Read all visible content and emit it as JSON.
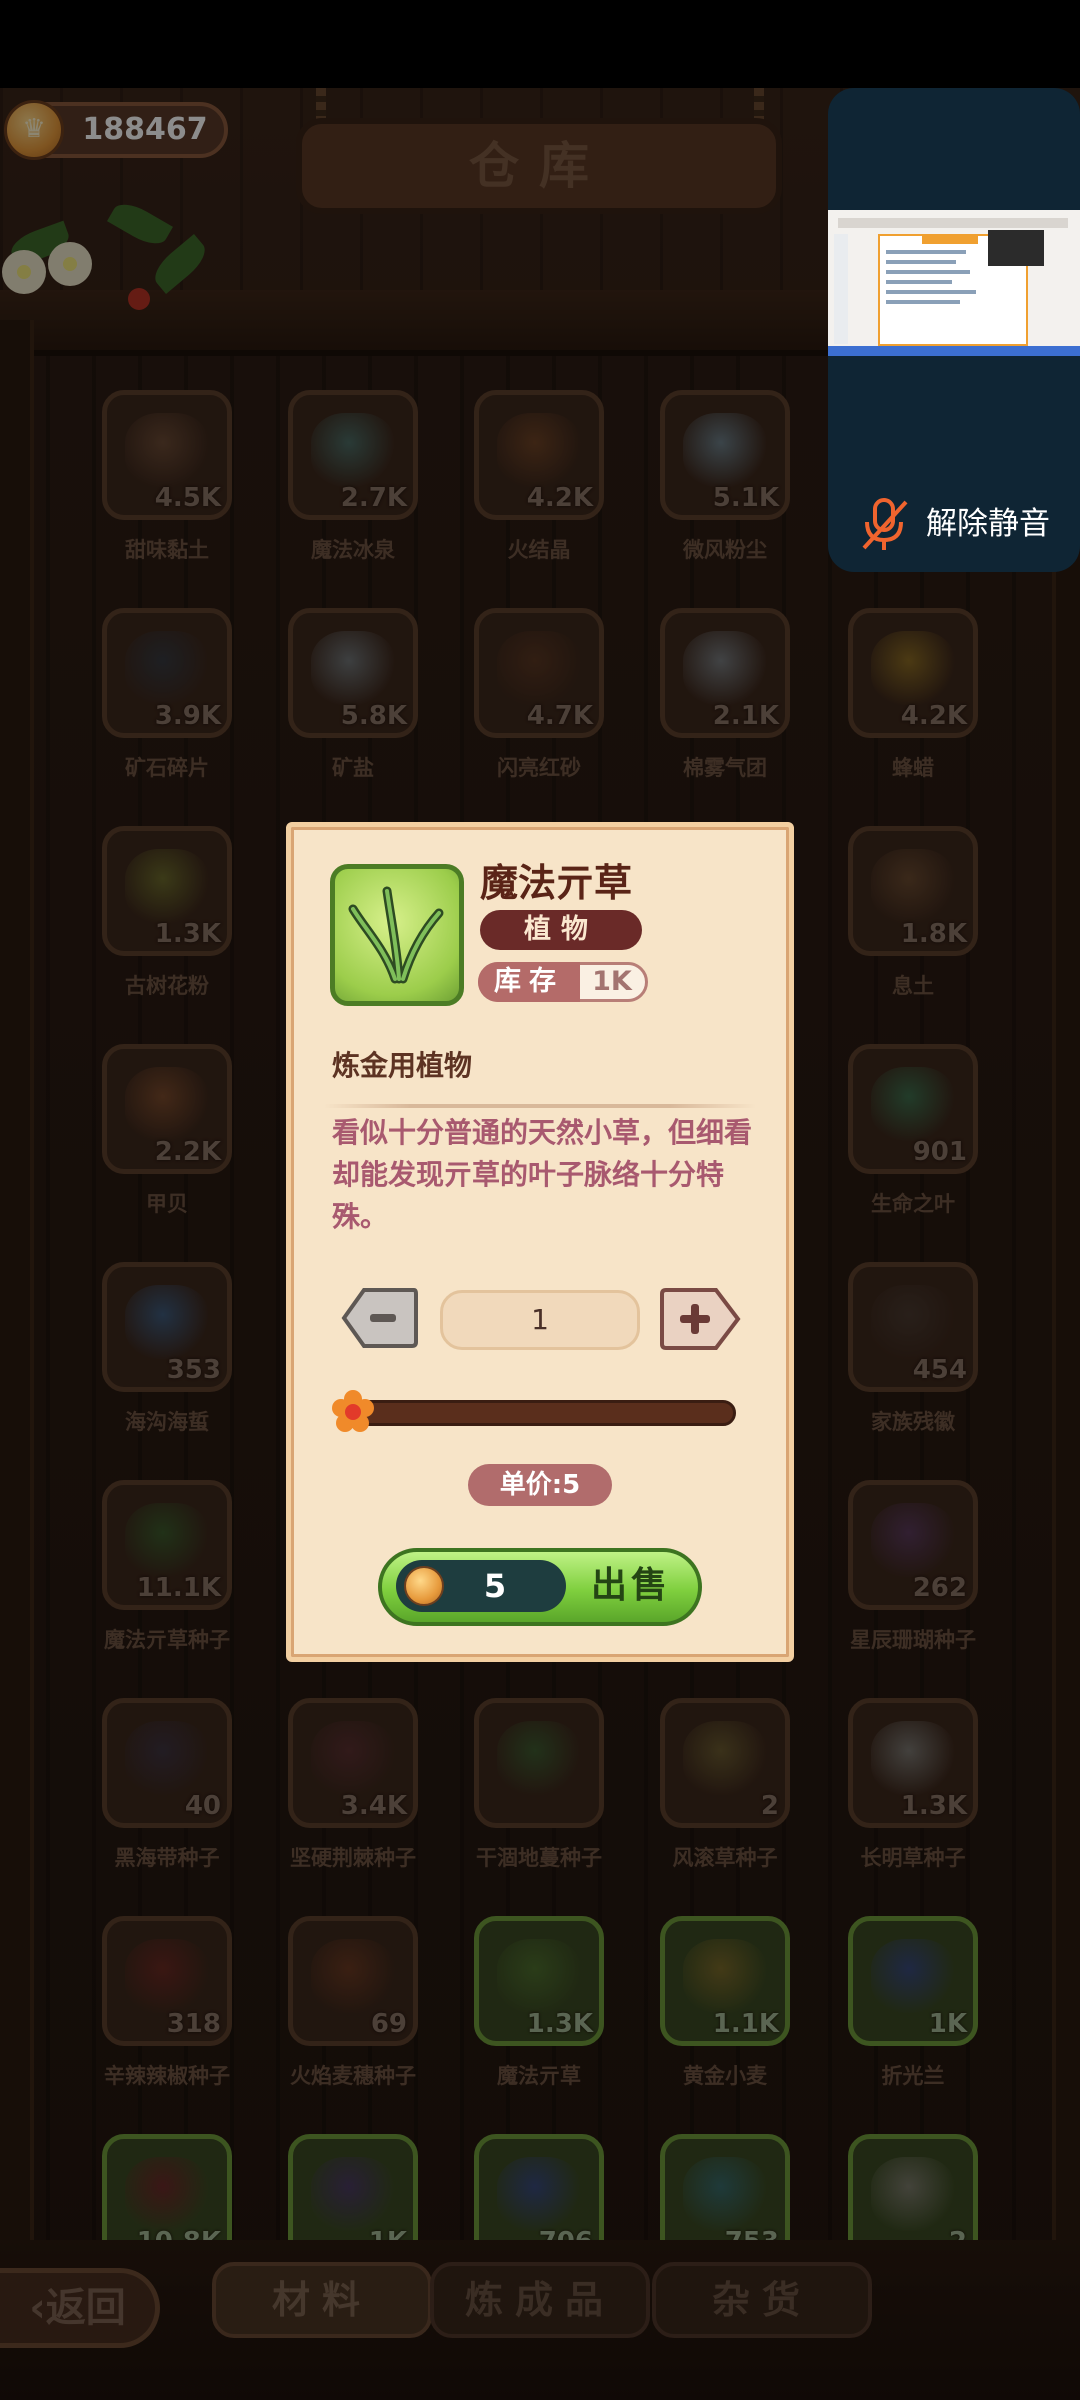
{
  "header": {
    "coins": "188467",
    "title": "仓库"
  },
  "mute_panel": {
    "label": "解除静音"
  },
  "inventory": [
    {
      "name": "甜味黏土",
      "count": "4.5K",
      "art": "#6b4a35"
    },
    {
      "name": "魔法冰泉",
      "count": "2.7K",
      "art": "#4d6b64"
    },
    {
      "name": "火结晶",
      "count": "4.2K",
      "art": "#6e4326"
    },
    {
      "name": "微风粉尘",
      "count": "5.1K",
      "art": "#6c7d86"
    },
    {
      "name": "",
      "count": "",
      "art": ""
    },
    {
      "name": "矿石碎片",
      "count": "3.9K",
      "art": "#383a40"
    },
    {
      "name": "矿盐",
      "count": "5.8K",
      "art": "#707476"
    },
    {
      "name": "闪亮红砂",
      "count": "4.7K",
      "art": "#5a3722"
    },
    {
      "name": "棉雾气团",
      "count": "2.1K",
      "art": "#777a7d"
    },
    {
      "name": "蜂蜡",
      "count": "4.2K",
      "art": "#8a6a24"
    },
    {
      "name": "古树花粉",
      "count": "1.3K",
      "art": "#6c6a2c"
    },
    {
      "name": "",
      "count": "",
      "art": ""
    },
    {
      "name": "",
      "count": "",
      "art": ""
    },
    {
      "name": "",
      "count": "",
      "art": ""
    },
    {
      "name": "息土",
      "count": "1.8K",
      "art": "#6a4a30"
    },
    {
      "name": "甲贝",
      "count": "2.2K",
      "art": "#7a4a2c"
    },
    {
      "name": "",
      "count": "",
      "art": ""
    },
    {
      "name": "",
      "count": "",
      "art": ""
    },
    {
      "name": "",
      "count": "",
      "art": ""
    },
    {
      "name": "生命之叶",
      "count": "901",
      "art": "#3f6d4c"
    },
    {
      "name": "海沟海蜇",
      "count": "353",
      "art": "#3f5a7a"
    },
    {
      "name": "",
      "count": "",
      "art": ""
    },
    {
      "name": "",
      "count": "",
      "art": ""
    },
    {
      "name": "",
      "count": "",
      "art": ""
    },
    {
      "name": "家族残徽",
      "count": "454",
      "art": "#4a3a30"
    },
    {
      "name": "魔法亓草种子",
      "count": "11.1K",
      "art": "#3d5a2c"
    },
    {
      "name": "",
      "count": "",
      "art": ""
    },
    {
      "name": "",
      "count": "",
      "art": ""
    },
    {
      "name": "",
      "count": "",
      "art": ""
    },
    {
      "name": "星辰珊瑚种子",
      "count": "262",
      "art": "#5a3a5a"
    },
    {
      "name": "黑海带种子",
      "count": "40",
      "art": "#3e3440"
    },
    {
      "name": "坚硬荆棘种子",
      "count": "3.4K",
      "art": "#5a3030"
    },
    {
      "name": "干涸地蔓种子",
      "count": "",
      "art": "#3f5a30"
    },
    {
      "name": "风滚草种子",
      "count": "2",
      "art": "#6a5a30"
    },
    {
      "name": "长明草种子",
      "count": "1.3K",
      "art": "#7a7670"
    },
    {
      "name": "辛辣辣椒种子",
      "count": "318",
      "art": "#6a2a22"
    },
    {
      "name": "火焰麦穗种子",
      "count": "69",
      "art": "#6a3a22"
    },
    {
      "name": "魔法亓草",
      "count": "1.3K",
      "art": "#4e6e2e",
      "green": true
    },
    {
      "name": "黄金小麦",
      "count": "1.1K",
      "art": "#7a6a2a",
      "green": true
    },
    {
      "name": "折光兰",
      "count": "1K",
      "art": "#3a4a7a",
      "green": true
    },
    {
      "name": "",
      "count": "10.8K",
      "art": "#6a2a28",
      "green": true
    },
    {
      "name": "",
      "count": "1K",
      "art": "#4a3a60",
      "green": true
    },
    {
      "name": "",
      "count": "706",
      "art": "#3a4a7a",
      "green": true
    },
    {
      "name": "",
      "count": "753",
      "art": "#3a6a6a",
      "green": true
    },
    {
      "name": "",
      "count": "2",
      "art": "#7a7a6a",
      "green": true
    }
  ],
  "bottom_nav": {
    "back": "返回",
    "tabs": [
      "材料",
      "炼成品",
      "杂货"
    ]
  },
  "popup": {
    "item_name": "魔法亓草",
    "category": "植物",
    "stock_label": "库存",
    "stock_value": "1K",
    "desc_title": "炼金用植物",
    "description": "看似十分普通的天然小草，但细看却能发现亓草的叶子脉络十分特殊。",
    "quantity": "1",
    "slider_fraction": 0,
    "unit_price": "单价:5",
    "sell_price": "5",
    "sell_label": "出售"
  }
}
